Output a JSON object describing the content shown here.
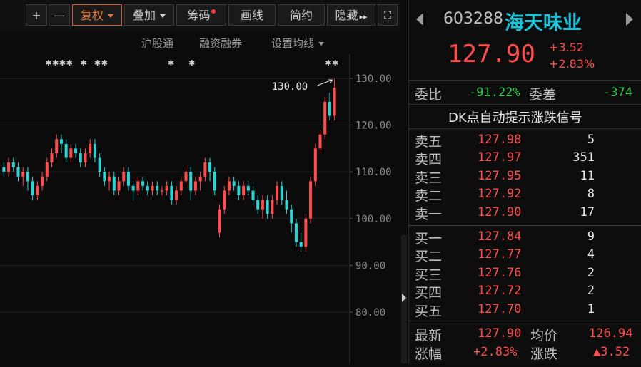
{
  "toolbar": {
    "plus": "+",
    "minus": "—",
    "fuquan": "复权",
    "diejia": "叠加",
    "choumа": "筹码",
    "huaxian": "画线",
    "jianyue": "简约",
    "yincang": "隐藏",
    "more": "▸▸",
    "fullscreen": "⛶"
  },
  "subbar": {
    "hugutong": "沪股通",
    "rongzi": "融资融券",
    "shezhi": "设置均线"
  },
  "chart_data": {
    "type": "candlestick",
    "yticks": [
      "130.00",
      "120.00",
      "110.00",
      "100.00",
      "90.00",
      "80.00"
    ],
    "ylim": [
      80,
      130
    ],
    "annotation": "130.00",
    "candles": [
      [
        111,
        110,
        112,
        109
      ],
      [
        110,
        112,
        113,
        109
      ],
      [
        112,
        111,
        113,
        110
      ],
      [
        111,
        109,
        112,
        108
      ],
      [
        109,
        110,
        111,
        107
      ],
      [
        110,
        108,
        111,
        106
      ],
      [
        108,
        105,
        109,
        104
      ],
      [
        105,
        107,
        108,
        104
      ],
      [
        107,
        109,
        110,
        106
      ],
      [
        109,
        112,
        113,
        108
      ],
      [
        112,
        114,
        115,
        111
      ],
      [
        114,
        117,
        118,
        113
      ],
      [
        117,
        116,
        118,
        114
      ],
      [
        116,
        113,
        117,
        112
      ],
      [
        113,
        115,
        116,
        112
      ],
      [
        115,
        114,
        116,
        113
      ],
      [
        114,
        112,
        115,
        111
      ],
      [
        112,
        114,
        115,
        111
      ],
      [
        114,
        116,
        117,
        113
      ],
      [
        116,
        113,
        117,
        112
      ],
      [
        113,
        110,
        114,
        109
      ],
      [
        110,
        108,
        111,
        107
      ],
      [
        108,
        109,
        110,
        106
      ],
      [
        109,
        106,
        110,
        105
      ],
      [
        106,
        108,
        109,
        105
      ],
      [
        108,
        110,
        111,
        107
      ],
      [
        110,
        107,
        111,
        106
      ],
      [
        107,
        106,
        108,
        104
      ],
      [
        106,
        108,
        109,
        105
      ],
      [
        108,
        107,
        109,
        106
      ],
      [
        107,
        106,
        108,
        105
      ],
      [
        106,
        107,
        108,
        105
      ],
      [
        107,
        106,
        108,
        105
      ],
      [
        106,
        106,
        107,
        105
      ],
      [
        106,
        107,
        108,
        105
      ],
      [
        107,
        104,
        108,
        103
      ],
      [
        104,
        106,
        107,
        103
      ],
      [
        106,
        108,
        109,
        105
      ],
      [
        108,
        110,
        111,
        107
      ],
      [
        110,
        106,
        111,
        104
      ],
      [
        106,
        108,
        109,
        105
      ],
      [
        108,
        109,
        110,
        106
      ],
      [
        109,
        112,
        113,
        108
      ],
      [
        112,
        110,
        113,
        108
      ],
      [
        110,
        106,
        111,
        105
      ],
      [
        97,
        102,
        103,
        96
      ],
      [
        102,
        106,
        107,
        101
      ],
      [
        106,
        108,
        109,
        105
      ],
      [
        108,
        107,
        109,
        106
      ],
      [
        107,
        105,
        108,
        104
      ],
      [
        105,
        107,
        108,
        104
      ],
      [
        107,
        106,
        108,
        105
      ],
      [
        106,
        104,
        107,
        103
      ],
      [
        104,
        102,
        105,
        101
      ],
      [
        102,
        104,
        105,
        100
      ],
      [
        104,
        101,
        105,
        100
      ],
      [
        101,
        104,
        105,
        100
      ],
      [
        104,
        107,
        108,
        103
      ],
      [
        107,
        104,
        108,
        103
      ],
      [
        104,
        102,
        106,
        101
      ],
      [
        102,
        99,
        103,
        97
      ],
      [
        99,
        95,
        100,
        94
      ],
      [
        95,
        94,
        97,
        93
      ],
      [
        94,
        100,
        101,
        93
      ],
      [
        100,
        108,
        109,
        99
      ],
      [
        108,
        115,
        116,
        107
      ],
      [
        115,
        118,
        119,
        114
      ],
      [
        118,
        125,
        126,
        117
      ],
      [
        125,
        122,
        127,
        121
      ],
      [
        122,
        128,
        130,
        121
      ]
    ]
  },
  "stock": {
    "code": "603288",
    "name": "海天味业",
    "price": "127.90",
    "change": "+3.52",
    "change_pct": "+2.83%"
  },
  "ratio": {
    "weibi_label": "委比",
    "weibi_value": "-91.22%",
    "weicha_label": "委差",
    "weicha_value": "-374"
  },
  "signal_link": "DK点自动提示涨跌信号",
  "asks": [
    {
      "label": "卖五",
      "price": "127.98",
      "vol": "5"
    },
    {
      "label": "卖四",
      "price": "127.97",
      "vol": "351"
    },
    {
      "label": "卖三",
      "price": "127.95",
      "vol": "11"
    },
    {
      "label": "卖二",
      "price": "127.92",
      "vol": "8"
    },
    {
      "label": "卖一",
      "price": "127.90",
      "vol": "17"
    }
  ],
  "bids": [
    {
      "label": "买一",
      "price": "127.84",
      "vol": "9"
    },
    {
      "label": "买二",
      "price": "127.77",
      "vol": "4"
    },
    {
      "label": "买三",
      "price": "127.76",
      "vol": "2"
    },
    {
      "label": "买四",
      "price": "127.72",
      "vol": "2"
    },
    {
      "label": "买五",
      "price": "127.70",
      "vol": "1"
    }
  ],
  "summary": {
    "zuixin_label": "最新",
    "zuixin_value": "127.90",
    "junjia_label": "均价",
    "junjia_value": "126.94",
    "zhangfu_label": "涨幅",
    "zhangfu_value": "+2.83%",
    "zhangdie_label": "涨跌",
    "zhangdie_value": "▲3.52"
  },
  "colors": {
    "up": "#ff4d4d",
    "down": "#2fd3d3",
    "accent": "#e07a3a",
    "name": "#19c4d8"
  }
}
